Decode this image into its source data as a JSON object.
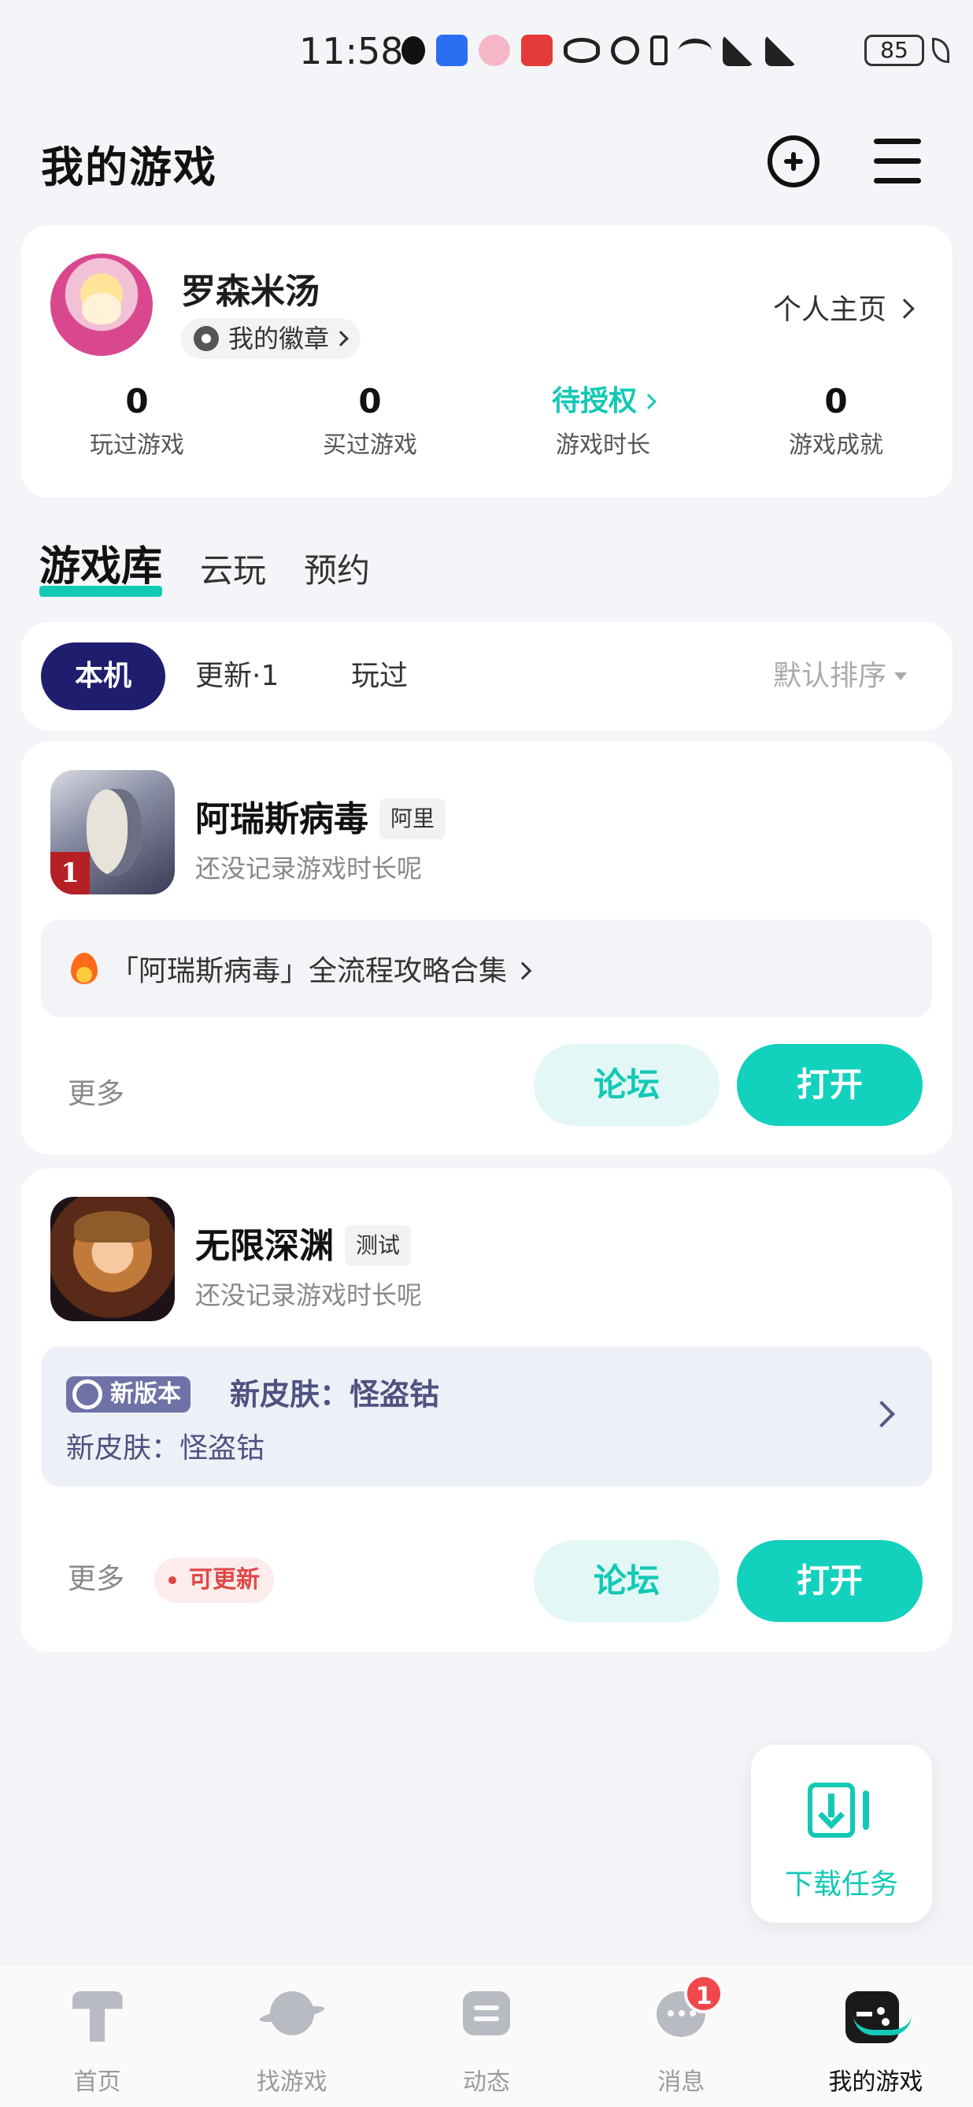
{
  "status_bar": {
    "time": "11:58",
    "battery": "85",
    "icons": [
      "qq-icon",
      "app-icon",
      "app-icon",
      "app-icon",
      "eye-icon",
      "alarm-icon",
      "vibrate-icon",
      "wifi-icon",
      "signal-4g-icon",
      "signal-4g-icon"
    ]
  },
  "header": {
    "title": "我的游戏",
    "add_icon": "plus-circle-icon",
    "menu_icon": "menu-icon"
  },
  "profile": {
    "name": "罗森米汤",
    "badge_label": "我的徽章",
    "home_link": "个人主页",
    "stats": [
      {
        "value": "0",
        "label": "玩过游戏"
      },
      {
        "value": "0",
        "label": "买过游戏"
      },
      {
        "value": "待授权",
        "label": "游戏时长"
      },
      {
        "value": "0",
        "label": "游戏成就"
      }
    ]
  },
  "library_tabs": [
    "游戏库",
    "云玩",
    "预约"
  ],
  "filters": {
    "chips": [
      "本机",
      "更新·1",
      "玩过"
    ],
    "sort": "默认排序"
  },
  "games": [
    {
      "name": "阿瑞斯病毒",
      "tag": "阿里",
      "subtitle": "还没记录游戏时长呢",
      "icon_badge": "1",
      "promo": "「阿瑞斯病毒」全流程攻略合集",
      "more": "更多",
      "forum": "论坛",
      "open": "打开"
    },
    {
      "name": "无限深渊",
      "tag": "测试",
      "subtitle": "还没记录游戏时长呢",
      "news_badge": "新版本",
      "news_title": "新皮肤：怪盗钴",
      "news_desc": "新皮肤：怪盗钴",
      "more": "更多",
      "update": "可更新",
      "forum": "论坛",
      "open": "打开"
    }
  ],
  "download_task": "下载任务",
  "bottom_nav": [
    {
      "label": "首页",
      "icon": "home-icon"
    },
    {
      "label": "找游戏",
      "icon": "planet-icon"
    },
    {
      "label": "动态",
      "icon": "feed-icon"
    },
    {
      "label": "消息",
      "icon": "message-icon",
      "badge": "1"
    },
    {
      "label": "我的游戏",
      "icon": "gamepad-icon"
    }
  ],
  "colors": {
    "accent": "#12c9b5",
    "chip_active": "#1f1d6e",
    "news_badge": "#6e72a6",
    "update_red": "#e04848",
    "background": "#f4f5f8"
  }
}
